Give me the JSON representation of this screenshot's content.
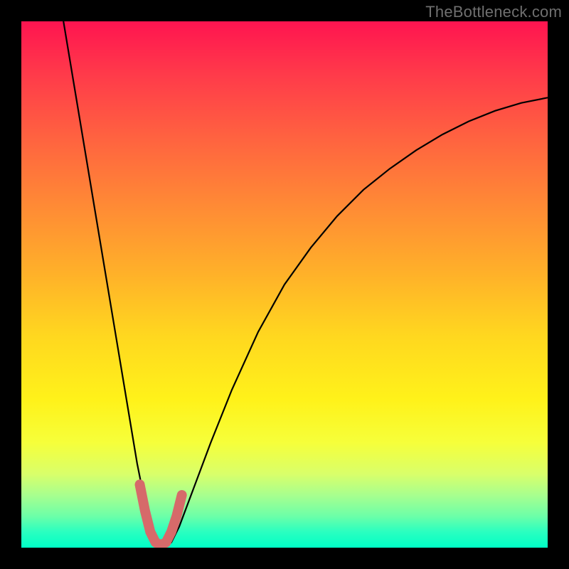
{
  "watermark": "TheBottleneck.com",
  "chart_data": {
    "type": "line",
    "title": "",
    "xlabel": "",
    "ylabel": "",
    "xlim": [
      0,
      100
    ],
    "ylim": [
      0,
      100
    ],
    "gradient_stops": [
      {
        "pos": 0,
        "color": "#ff1450"
      },
      {
        "pos": 10,
        "color": "#ff3a4a"
      },
      {
        "pos": 22,
        "color": "#ff6240"
      },
      {
        "pos": 35,
        "color": "#ff8a35"
      },
      {
        "pos": 48,
        "color": "#ffb129"
      },
      {
        "pos": 60,
        "color": "#ffd81f"
      },
      {
        "pos": 72,
        "color": "#fff21a"
      },
      {
        "pos": 80,
        "color": "#f6ff3a"
      },
      {
        "pos": 86,
        "color": "#d9ff6a"
      },
      {
        "pos": 90,
        "color": "#a8ff8e"
      },
      {
        "pos": 94,
        "color": "#6dffa8"
      },
      {
        "pos": 97,
        "color": "#2affc0"
      },
      {
        "pos": 100,
        "color": "#00ffc6"
      }
    ],
    "series": [
      {
        "name": "curve",
        "color": "#000000",
        "x": [
          8,
          10,
          12,
          14,
          16,
          18,
          20,
          22,
          24,
          25.5,
          27,
          28.5,
          30,
          33,
          36,
          40,
          45,
          50,
          55,
          60,
          65,
          70,
          75,
          80,
          85,
          90,
          95,
          100
        ],
        "y": [
          100,
          88,
          76,
          64,
          52,
          40,
          28,
          16,
          6,
          1,
          0,
          1,
          4,
          12,
          20,
          30,
          41,
          50,
          57,
          63,
          68,
          72,
          75.5,
          78.5,
          81,
          83,
          84.5,
          85.5
        ]
      },
      {
        "name": "highlight-segment",
        "color": "#d66a6a",
        "x": [
          22.5,
          23.5,
          24.5,
          25.5,
          26.5,
          27.5,
          28.5,
          29.5,
          30.5
        ],
        "y": [
          12,
          7,
          3,
          1,
          0.5,
          1,
          3,
          6,
          10
        ]
      }
    ],
    "notes": "Background is a vertical red→yellow→green gradient. Curve is a V-shape with minimum near x≈27, y≈0. A thick salmon segment highlights the bottom of the V. Frame has a thick black border (~30px)."
  }
}
